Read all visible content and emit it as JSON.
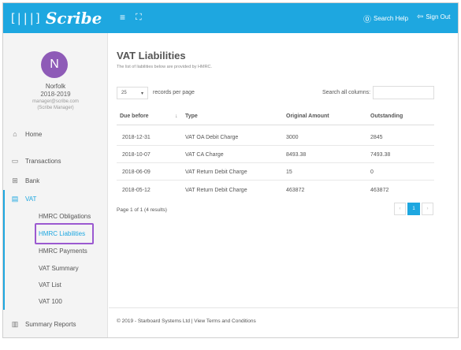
{
  "brand": {
    "mark": "[|||]",
    "name": "Scribe"
  },
  "topbar": {
    "menu_icon": "≡",
    "expand_icon": "⛶",
    "help_label": "Search Help",
    "signout_label": "Sign Out"
  },
  "user": {
    "initial": "N",
    "name": "Norfolk",
    "year": "2018-2019",
    "email": "manager@scribe.com",
    "role": "(Scribe Manager)",
    "avatar_color": "#8e5bb7"
  },
  "nav": {
    "home": "Home",
    "transactions": "Transactions",
    "bank": "Bank",
    "vat": "VAT",
    "vat_items": [
      "HMRC Obligations",
      "HMRC Liabilities",
      "HMRC Payments",
      "VAT Summary",
      "VAT List",
      "VAT 100"
    ],
    "summary_reports": "Summary Reports"
  },
  "page": {
    "title": "VAT Liabilities",
    "subtitle": "The list of liabilities below are provided by HMRC."
  },
  "table_controls": {
    "length_value": "25",
    "length_label": "records per page",
    "search_label": "Search all columns:",
    "search_value": ""
  },
  "table": {
    "columns": [
      "Due before",
      "Type",
      "Original Amount",
      "Outstanding"
    ],
    "rows": [
      [
        "2018-12-31",
        "VAT OA Debit Charge",
        "3000",
        "2845"
      ],
      [
        "2018-10-07",
        "VAT CA Charge",
        "8493.38",
        "7493.38"
      ],
      [
        "2018-06-09",
        "VAT Return Debit Charge",
        "15",
        "0"
      ],
      [
        "2018-05-12",
        "VAT Return Debit Charge",
        "463872",
        "463872"
      ]
    ]
  },
  "pagination": {
    "info": "Page 1 of 1 (4 results)",
    "prev": "‹",
    "current": "1",
    "next": "›"
  },
  "footer": {
    "text": "© 2019 - Starboard Systems Ltd | View Terms and Conditions"
  },
  "colors": {
    "accent": "#1ea7e0",
    "highlight": "#9b59d0",
    "sidebar_bg": "#f4f4f4"
  }
}
